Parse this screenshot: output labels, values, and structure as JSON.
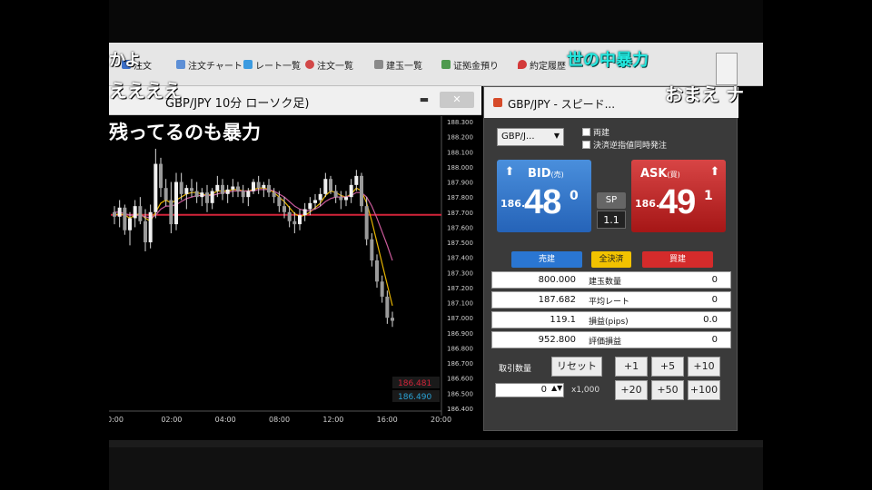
{
  "comments": [
    "かよ",
    "ええええ",
    "残ってるのも暴力",
    "世の中暴力",
    "おまえ ナ"
  ],
  "toolbar": {
    "items": [
      {
        "label": "注文",
        "icon": "order-icon"
      },
      {
        "label": "注文チャート",
        "icon": "chart-icon"
      },
      {
        "label": "レート一覧",
        "icon": "rate-icon"
      },
      {
        "label": "注文一覧",
        "icon": "list-icon"
      },
      {
        "label": "建玉一覧",
        "icon": "position-icon"
      },
      {
        "label": "证拠金預り",
        "icon": "margin-icon"
      },
      {
        "label": "約定履歴",
        "icon": "history-icon"
      }
    ]
  },
  "chart_window": {
    "title": "GBP/JPY 10分 ローソク足)",
    "minimize": "▬",
    "close": "✕"
  },
  "order_window": {
    "title": "GBP/JPY - スピード...",
    "pair_select": "GBP/J...",
    "option_both_ways": "両建",
    "option_settle": "決済逆指値同時発注",
    "bid": {
      "label": "BID",
      "sub": "(売)",
      "prefix": "186.",
      "big": "48",
      "pip": "0"
    },
    "ask": {
      "label": "ASK",
      "sub": "(買)",
      "prefix": "186.",
      "big": "49",
      "pip": "1"
    },
    "spread_label": "SP",
    "spread_value": "1.1",
    "sell_label": "売建",
    "close_all_label": "全決済",
    "buy_label": "買建",
    "positions": [
      {
        "value": "800.000",
        "label": "建玉数量",
        "right": "0"
      },
      {
        "value": "187.682",
        "label": "平均レート",
        "right": "0"
      },
      {
        "value": "119.1",
        "label": "損益(pips)",
        "right": "0.0"
      },
      {
        "value": "952.800",
        "label": "評価損益",
        "right": "0"
      }
    ],
    "qty_label": "取引数量",
    "reset_label": "リセット",
    "qty_value": "0",
    "qty_unit": "x1,000",
    "step_buttons": [
      "+1",
      "+5",
      "+10",
      "+20",
      "+50",
      "+100"
    ]
  },
  "chart_data": {
    "type": "candlestick",
    "yticks": [
      "188.300",
      "188.200",
      "188.100",
      "188.000",
      "187.900",
      "187.800",
      "187.700",
      "187.600",
      "187.500",
      "187.400",
      "187.300",
      "187.200",
      "187.100",
      "187.000",
      "186.900",
      "186.800",
      "186.700",
      "186.600",
      "186.500",
      "186.400"
    ],
    "xticks": [
      "0:00",
      "02:00",
      "04:00",
      "08:00",
      "12:00",
      "16:00",
      "20:00"
    ],
    "ylim": [
      186.4,
      188.3
    ],
    "avg_rate": 187.682,
    "last_bid": "186.481",
    "last_ask": "186.490",
    "colors": {
      "up": "#e8e8e8",
      "down": "#e8e8e8",
      "ma1": "#e7b400",
      "ma2": "#c95a9a",
      "avg": "#d2243a",
      "bid_tag": "#d2243a",
      "ask_tag": "#2aa3d6"
    },
    "candles": [
      [
        187.7,
        187.74,
        187.62,
        187.67
      ],
      [
        187.67,
        187.78,
        187.6,
        187.73
      ],
      [
        187.73,
        187.75,
        187.55,
        187.58
      ],
      [
        187.58,
        187.7,
        187.48,
        187.66
      ],
      [
        187.66,
        187.78,
        187.6,
        187.74
      ],
      [
        187.74,
        187.8,
        187.62,
        187.64
      ],
      [
        187.64,
        187.72,
        187.44,
        187.5
      ],
      [
        187.5,
        187.75,
        187.46,
        187.7
      ],
      [
        187.7,
        188.12,
        187.66,
        188.02
      ],
      [
        188.02,
        188.06,
        187.8,
        187.86
      ],
      [
        187.86,
        187.92,
        187.74,
        187.78
      ],
      [
        187.78,
        187.9,
        187.56,
        187.62
      ],
      [
        187.62,
        187.96,
        187.58,
        187.9
      ],
      [
        187.9,
        187.96,
        187.78,
        187.82
      ],
      [
        187.82,
        187.88,
        187.72,
        187.86
      ],
      [
        187.86,
        187.92,
        187.8,
        187.84
      ],
      [
        187.84,
        187.9,
        187.76,
        187.8
      ],
      [
        187.8,
        187.86,
        187.74,
        187.83
      ],
      [
        187.83,
        187.88,
        187.7,
        187.76
      ],
      [
        187.76,
        187.86,
        187.72,
        187.84
      ],
      [
        187.84,
        187.94,
        187.8,
        187.88
      ],
      [
        187.88,
        187.92,
        187.78,
        187.82
      ],
      [
        187.82,
        187.88,
        187.76,
        187.85
      ],
      [
        187.85,
        187.92,
        187.8,
        187.87
      ],
      [
        187.87,
        187.9,
        187.8,
        187.84
      ],
      [
        187.84,
        187.88,
        187.76,
        187.8
      ],
      [
        187.8,
        187.86,
        187.74,
        187.84
      ],
      [
        187.84,
        187.92,
        187.82,
        187.9
      ],
      [
        187.9,
        187.94,
        187.82,
        187.86
      ],
      [
        187.86,
        187.9,
        187.8,
        187.88
      ],
      [
        187.88,
        187.92,
        187.8,
        187.83
      ],
      [
        187.83,
        187.86,
        187.76,
        187.8
      ],
      [
        187.8,
        187.84,
        187.7,
        187.74
      ],
      [
        187.74,
        187.8,
        187.66,
        187.7
      ],
      [
        187.7,
        187.74,
        187.6,
        187.64
      ],
      [
        187.64,
        187.7,
        187.56,
        187.62
      ],
      [
        187.62,
        187.72,
        187.58,
        187.68
      ],
      [
        187.68,
        187.76,
        187.64,
        187.72
      ],
      [
        187.72,
        187.8,
        187.68,
        187.76
      ],
      [
        187.76,
        187.82,
        187.72,
        187.78
      ],
      [
        187.78,
        187.86,
        187.74,
        187.82
      ],
      [
        187.82,
        187.96,
        187.8,
        187.92
      ],
      [
        187.92,
        187.94,
        187.82,
        187.84
      ],
      [
        187.84,
        187.88,
        187.76,
        187.8
      ],
      [
        187.8,
        187.84,
        187.72,
        187.78
      ],
      [
        187.78,
        187.84,
        187.74,
        187.8
      ],
      [
        187.8,
        187.92,
        187.76,
        187.88
      ],
      [
        187.88,
        187.98,
        187.84,
        187.94
      ],
      [
        187.94,
        187.96,
        187.7,
        187.74
      ],
      [
        187.74,
        187.8,
        187.48,
        187.52
      ],
      [
        187.52,
        187.56,
        187.34,
        187.38
      ],
      [
        187.38,
        187.42,
        187.2,
        187.24
      ],
      [
        187.24,
        187.28,
        187.1,
        187.14
      ],
      [
        187.14,
        187.18,
        186.96,
        187.0
      ],
      [
        187.0,
        187.04,
        186.94,
        186.98
      ]
    ],
    "ma1": [
      187.68,
      187.69,
      187.68,
      187.66,
      187.68,
      187.69,
      187.66,
      187.64,
      187.7,
      187.76,
      187.78,
      187.76,
      187.78,
      187.8,
      187.82,
      187.83,
      187.83,
      187.82,
      187.81,
      187.82,
      187.84,
      187.84,
      187.84,
      187.85,
      187.85,
      187.84,
      187.84,
      187.85,
      187.86,
      187.86,
      187.85,
      187.83,
      187.8,
      187.77,
      187.73,
      187.69,
      187.67,
      187.68,
      187.7,
      187.73,
      187.76,
      187.81,
      187.84,
      187.83,
      187.81,
      187.8,
      187.82,
      187.86,
      187.84,
      187.76,
      187.64,
      187.5,
      187.36,
      187.22,
      187.08
    ],
    "ma2": [
      187.7,
      187.7,
      187.69,
      187.68,
      187.68,
      187.68,
      187.67,
      187.66,
      187.68,
      187.72,
      187.74,
      187.74,
      187.75,
      187.77,
      187.79,
      187.8,
      187.81,
      187.81,
      187.81,
      187.81,
      187.82,
      187.83,
      187.83,
      187.84,
      187.84,
      187.84,
      187.84,
      187.84,
      187.85,
      187.85,
      187.85,
      187.84,
      187.82,
      187.8,
      187.77,
      187.74,
      187.72,
      187.71,
      187.71,
      187.72,
      187.74,
      187.77,
      187.79,
      187.8,
      187.8,
      187.8,
      187.81,
      187.83,
      187.83,
      187.8,
      187.74,
      187.66,
      187.57,
      187.48,
      187.38
    ]
  }
}
